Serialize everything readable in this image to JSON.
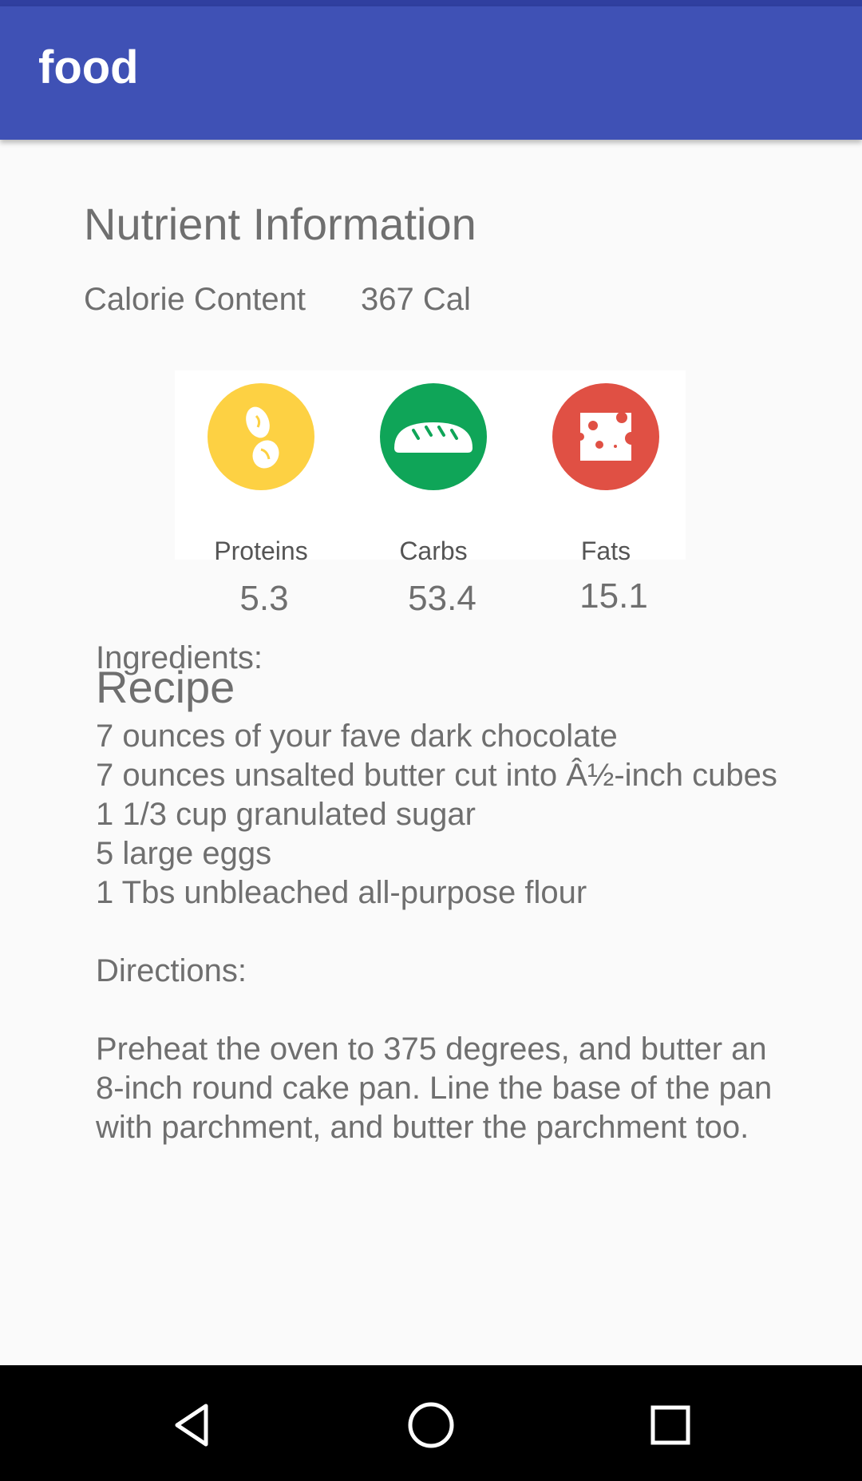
{
  "app": {
    "title": "food",
    "colors": {
      "primary": "#3f51b5",
      "primary_dark": "#303f9f",
      "background": "#fafafa",
      "text": "#6f6f6f",
      "protein": "#fdd143",
      "carbs": "#0fa558",
      "fats": "#e05044"
    }
  },
  "nutrients": {
    "title": "Nutrient Information",
    "calorie_label": "Calorie Content",
    "calorie_value": "367 Cal",
    "items": [
      {
        "label": "Proteins",
        "value": "5.3",
        "icon": "bean-icon",
        "color": "#fdd143"
      },
      {
        "label": "Carbs",
        "value": "53.4",
        "icon": "bread-icon",
        "color": "#0fa558"
      },
      {
        "label": "Fats",
        "value": "15.1",
        "icon": "cheese-icon",
        "color": "#e05044"
      }
    ]
  },
  "recipe": {
    "title": "Recipe",
    "ingredients_heading": "Ingredients:",
    "ingredients": [
      "7 ounces of your fave dark chocolate",
      "7 ounces unsalted butter cut into Â½-inch cubes",
      "1 1/3 cup granulated sugar",
      "5 large eggs",
      "1 Tbs unbleached all-purpose flour"
    ],
    "directions_heading": "Directions:",
    "directions": [
      "Preheat the oven to 375 degrees, and butter an",
      "8-inch round cake pan. Line the base of the pan",
      "with parchment, and butter the parchment too."
    ]
  },
  "navbar": {
    "icons": [
      "back-icon",
      "home-icon",
      "recents-icon"
    ]
  }
}
